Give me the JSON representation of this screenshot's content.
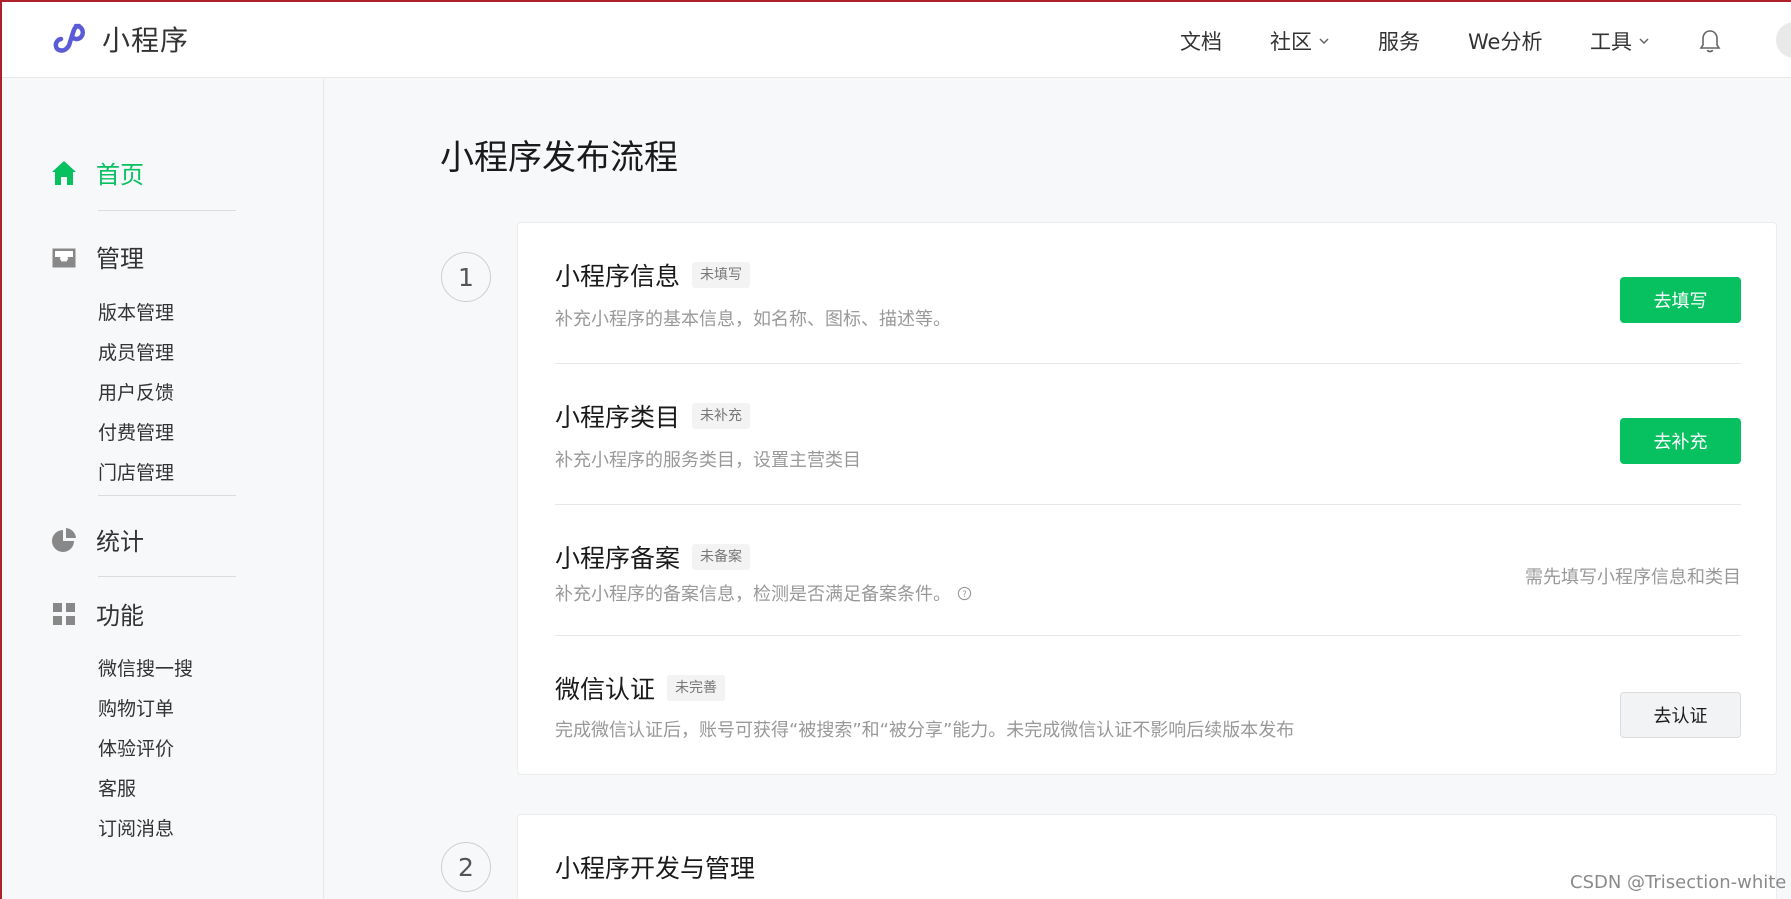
{
  "colors": {
    "accent": "#07c160",
    "brand_logo": "#5b5bd6",
    "border_window": "#b0202a"
  },
  "app": {
    "logo_icon": "mini-program-logo-icon",
    "title": "小程序"
  },
  "topnav": {
    "docs": "文档",
    "community": "社区",
    "services": "服务",
    "analytics": "We分析",
    "tools": "工具",
    "bell_icon": "bell-icon",
    "avatar_icon": "avatar"
  },
  "sidebar": {
    "home": {
      "label": "首页",
      "icon": "home-icon"
    },
    "manage": {
      "label": "管理",
      "icon": "inbox-icon",
      "items": [
        "版本管理",
        "成员管理",
        "用户反馈",
        "付费管理",
        "门店管理"
      ]
    },
    "stats": {
      "label": "统计",
      "icon": "pie-chart-icon"
    },
    "features": {
      "label": "功能",
      "icon": "grid-icon",
      "items": [
        "微信搜一搜",
        "购物订单",
        "体验评价",
        "客服",
        "订阅消息"
      ]
    }
  },
  "main": {
    "title": "小程序发布流程",
    "step1": {
      "number": "1",
      "rows": [
        {
          "title": "小程序信息",
          "tag": "未填写",
          "desc": "补充小程序的基本信息，如名称、图标、描述等。",
          "button": "去填写"
        },
        {
          "title": "小程序类目",
          "tag": "未补充",
          "desc": "补充小程序的服务类目，设置主营类目",
          "button": "去补充"
        },
        {
          "title": "小程序备案",
          "tag": "未备案",
          "desc": "补充小程序的备案信息，检测是否满足备案条件。",
          "note": "需先填写小程序信息和类目"
        },
        {
          "title": "微信认证",
          "tag": "未完善",
          "desc": "完成微信认证后，账号可获得“被搜索”和“被分享”能力。未完成微信认证不影响后续版本发布",
          "button": "去认证"
        }
      ]
    },
    "step2": {
      "number": "2",
      "title": "小程序开发与管理"
    }
  },
  "watermark": "CSDN @Trisection-white"
}
